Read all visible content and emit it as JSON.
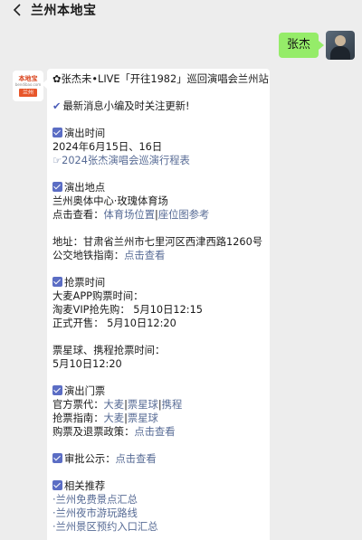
{
  "header": {
    "back_icon": "chevron-left-icon",
    "title": "兰州本地宝"
  },
  "chat": {
    "outgoing_message": "张杰",
    "bot_logo": {
      "top": "本地宝",
      "mid": "bendibao.com",
      "bottom": "兰州"
    }
  },
  "article": {
    "title": "✿张杰未•LIVE「开往1982」巡回演唱会兰州站",
    "tip": "最新消息小编及时关注更新!",
    "time": {
      "heading": "演出时间",
      "date": "2024年6月15日、16日",
      "tour_link": "☞2024张杰演唱会巡演行程表"
    },
    "venue": {
      "heading": "演出地点",
      "name": "兰州奥体中心·玫瑰体育场",
      "view_label": "点击查看：",
      "location_link": "体育场位置",
      "separator": "|",
      "seatmap_link": "座位图参考",
      "address": "地址：甘肃省兰州市七里河区西津西路1260号",
      "transit_label": "公交地铁指南：",
      "transit_link": "点击查看"
    },
    "tickets": {
      "heading": "抢票时间",
      "damai_label": "大麦APP购票时间：",
      "vip_presale": "淘麦VIP抢先购：  5月10日12:15",
      "general_sale": "正式开售：  5月10日12:20",
      "other_label": "票星球、携程抢票时间：",
      "other_time": "5月10日12:20"
    },
    "admission": {
      "heading": "演出门票",
      "official_label": "官方票代：",
      "agent1": "大麦",
      "agent2": "票星球",
      "agent3": "携程",
      "guide_label": "抢票指南：",
      "guide1": "大麦",
      "guide2": "票星球",
      "refund_label": "购票及退票政策：",
      "refund_link": "点击查看"
    },
    "approval": {
      "label": "审批公示：",
      "link": "点击查看"
    },
    "related": {
      "heading": "相关推荐",
      "items": [
        "·兰州免费景点汇总",
        "·兰州夜市游玩路线",
        "·兰州景区预约入口汇总"
      ]
    }
  },
  "colors": {
    "background": "#ededed",
    "outgoing_bubble": "#95ec69",
    "link": "#576b95",
    "checkbox": "#5b6dc4"
  }
}
